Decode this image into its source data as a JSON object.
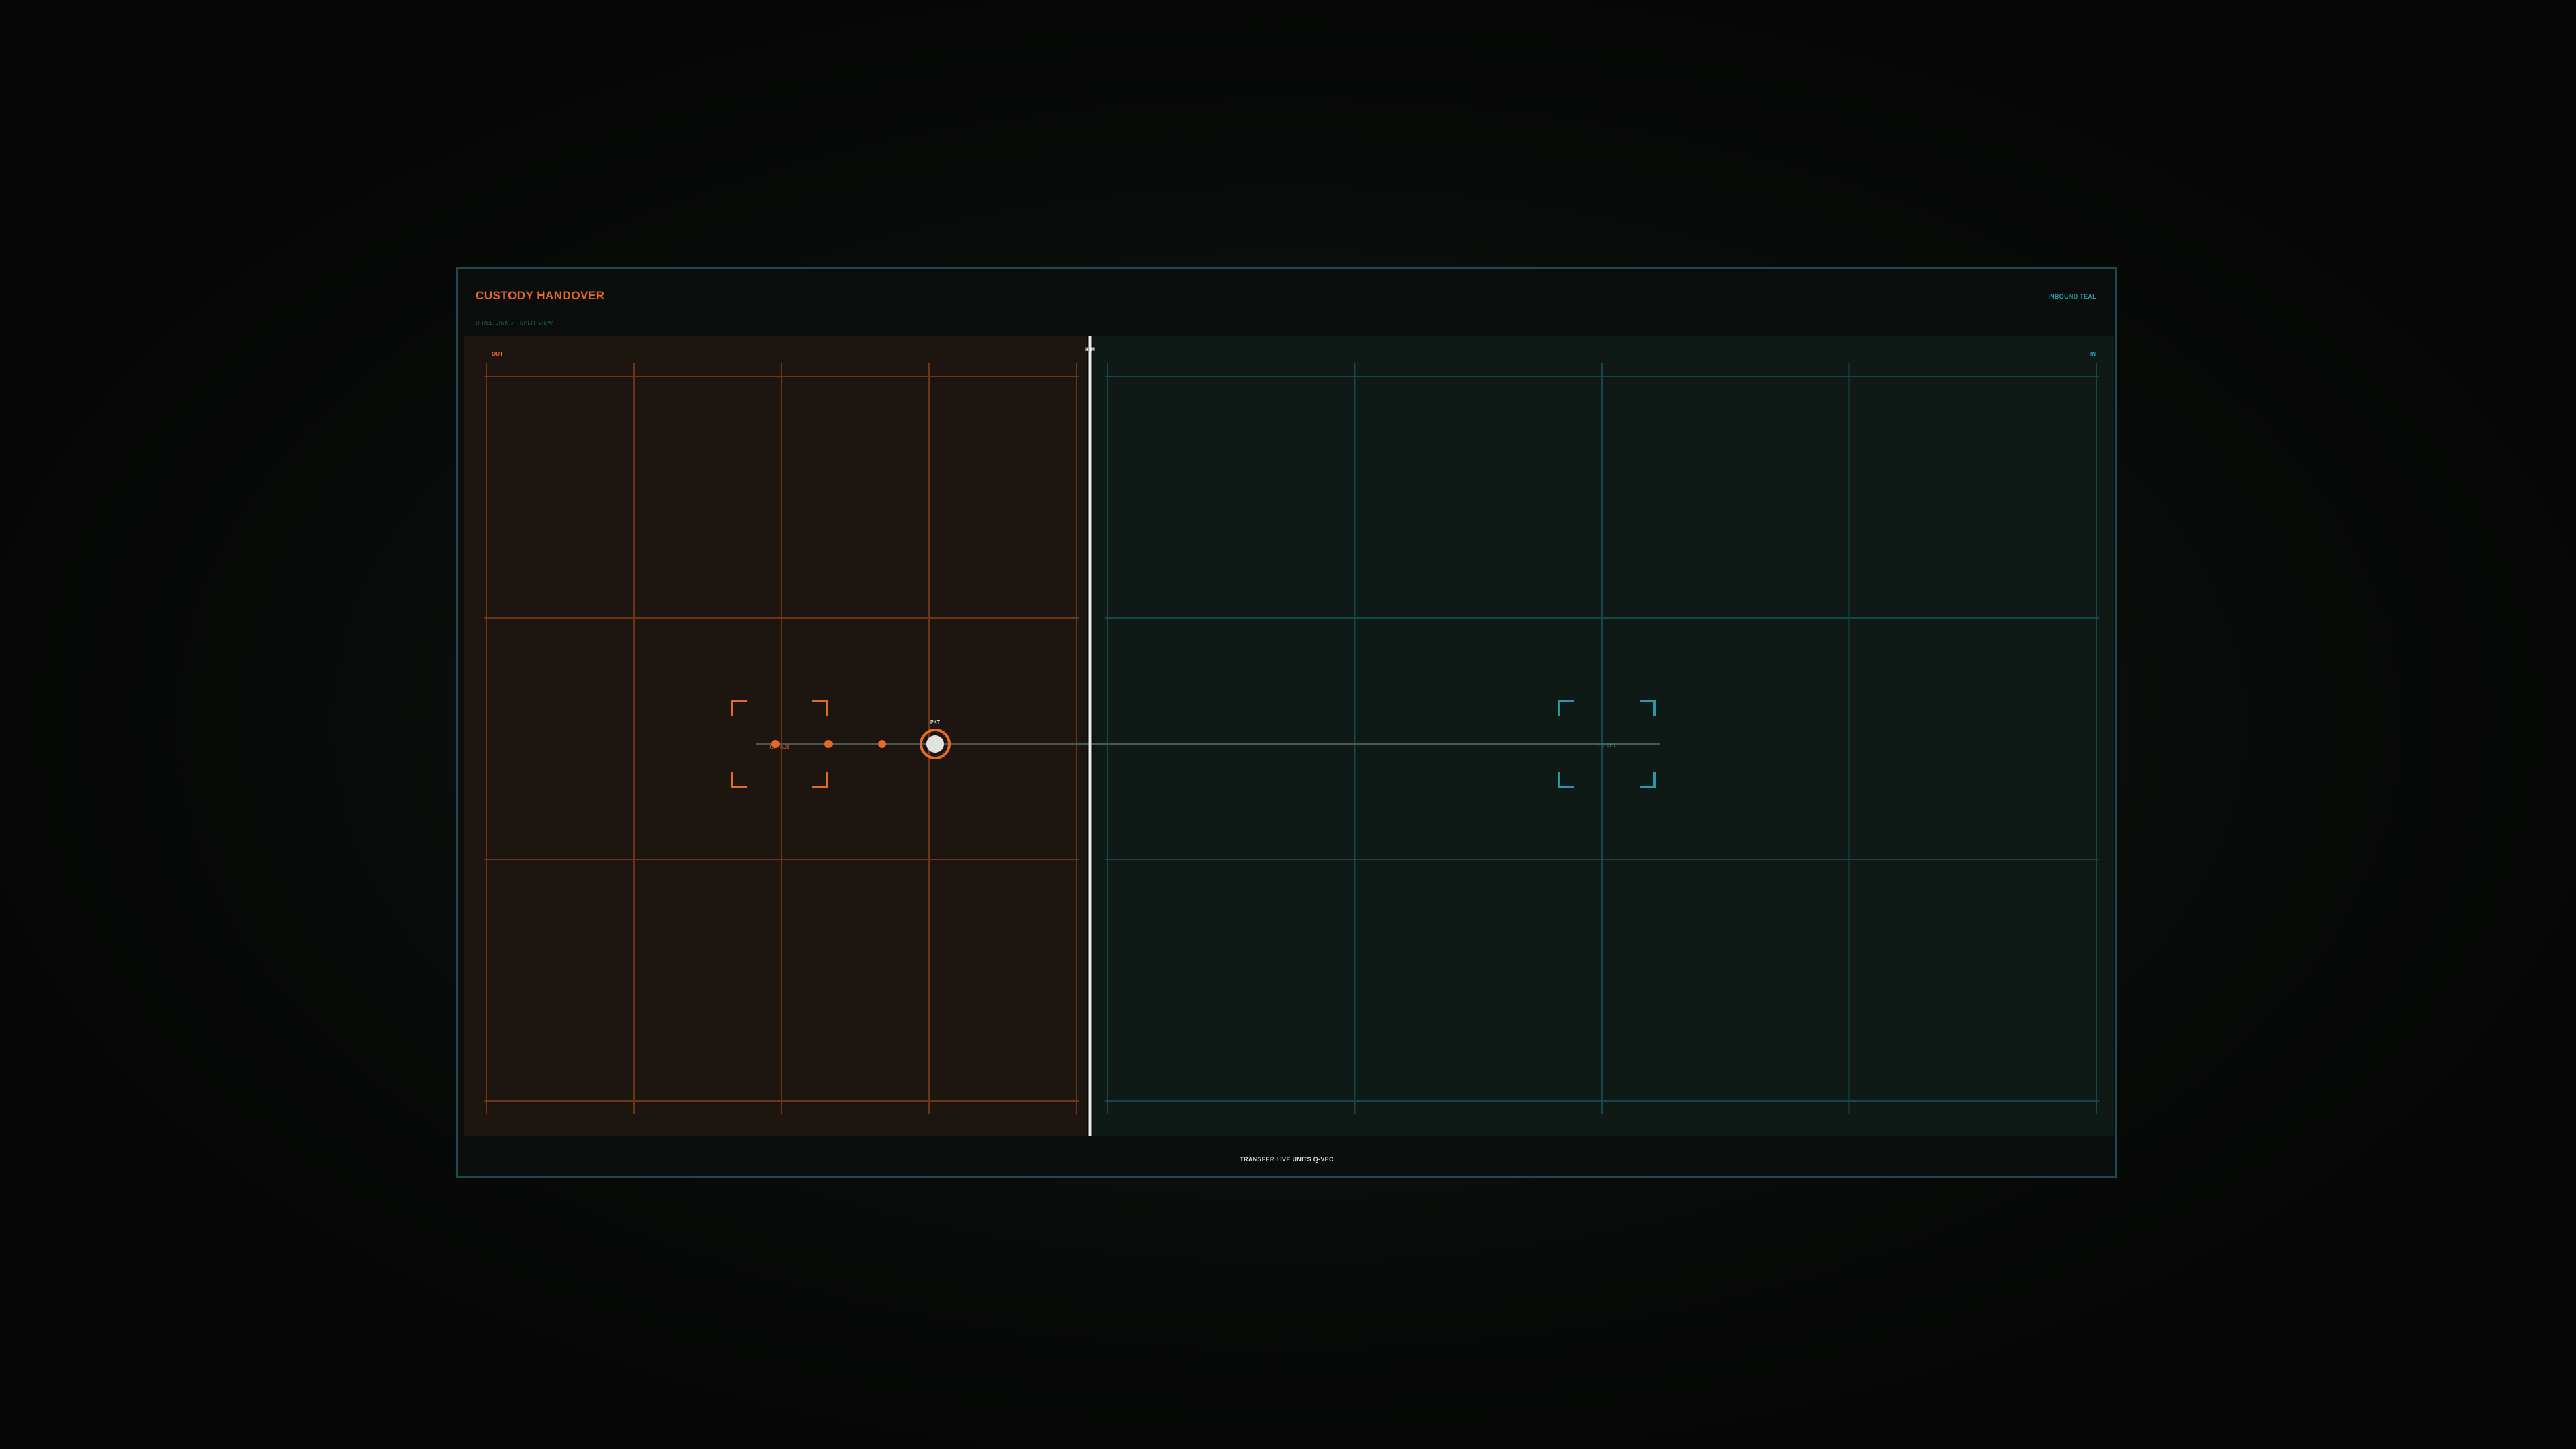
{
  "header": {
    "title": "CUSTODY HANDOVER",
    "subtitle": "D-REL-LINK 7 · SPLIT VIEW",
    "mode": "INBOUND TEAL"
  },
  "zones": {
    "left": {
      "label": "OUT",
      "color": "#e46a2c"
    },
    "right": {
      "label": "IN",
      "color": "#2a98a8"
    },
    "divider": {
      "label": "HDM",
      "color": "#e8ecea"
    }
  },
  "targets": {
    "source": {
      "label": "OR-A08",
      "color": "#e46a2c"
    },
    "destination": {
      "label": "TR-SP7",
      "color": "#2a98a8"
    }
  },
  "payload": {
    "label": "PKT",
    "color": "#e46a2c",
    "core_color": "#dfe3e1"
  },
  "footer": {
    "status": "TRANSFER LIVE UNITS Q-VEC"
  },
  "colors": {
    "left_bg": "#1c1510",
    "right_bg": "#0f1a16",
    "left_grid": "#6a3518",
    "right_grid": "#17474a",
    "path": "#4e5451"
  }
}
